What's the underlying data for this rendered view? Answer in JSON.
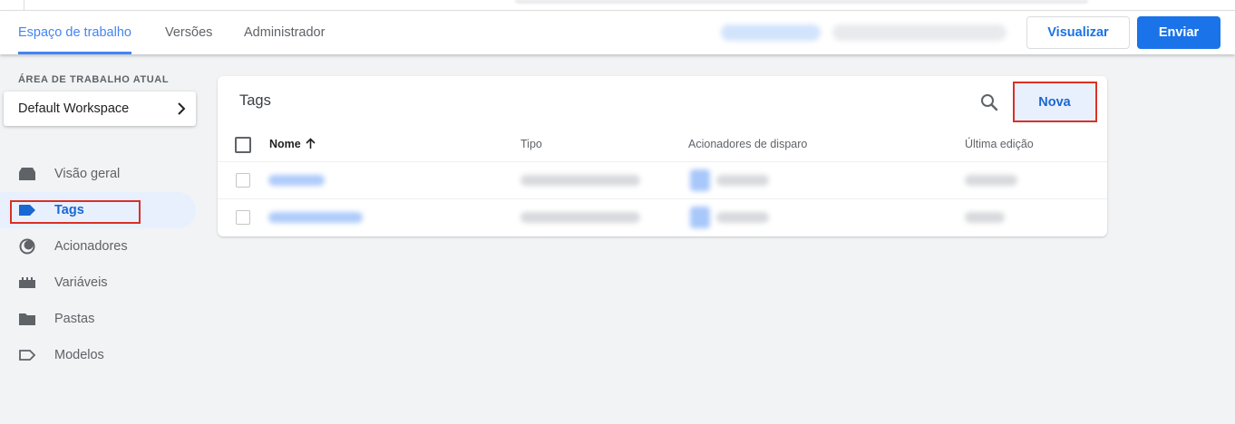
{
  "header": {
    "tabs": [
      {
        "label": "Espaço de trabalho",
        "active": true
      },
      {
        "label": "Versões",
        "active": false
      },
      {
        "label": "Administrador",
        "active": false
      }
    ],
    "preview_label": "Visualizar",
    "submit_label": "Enviar"
  },
  "sidebar": {
    "workspace_section_label": "ÁREA DE TRABALHO ATUAL",
    "workspace_name": "Default Workspace",
    "items": [
      {
        "label": "Visão geral",
        "icon": "overview-icon",
        "active": false
      },
      {
        "label": "Tags",
        "icon": "tag-icon",
        "active": true
      },
      {
        "label": "Acionadores",
        "icon": "trigger-icon",
        "active": false
      },
      {
        "label": "Variáveis",
        "icon": "variables-icon",
        "active": false
      },
      {
        "label": "Pastas",
        "icon": "folder-icon",
        "active": false
      },
      {
        "label": "Modelos",
        "icon": "template-icon",
        "active": false
      }
    ]
  },
  "tags_panel": {
    "title": "Tags",
    "new_label": "Nova",
    "columns": [
      "Nome",
      "Tipo",
      "Acionadores de disparo",
      "Última edição"
    ],
    "sort_column": "Nome",
    "sort_direction": "ascending"
  },
  "colors": {
    "accent": "#1a73e8",
    "active_tab": "#4285f4",
    "highlight_box": "#d93025",
    "active_nav_bg": "#e8f0fe"
  }
}
